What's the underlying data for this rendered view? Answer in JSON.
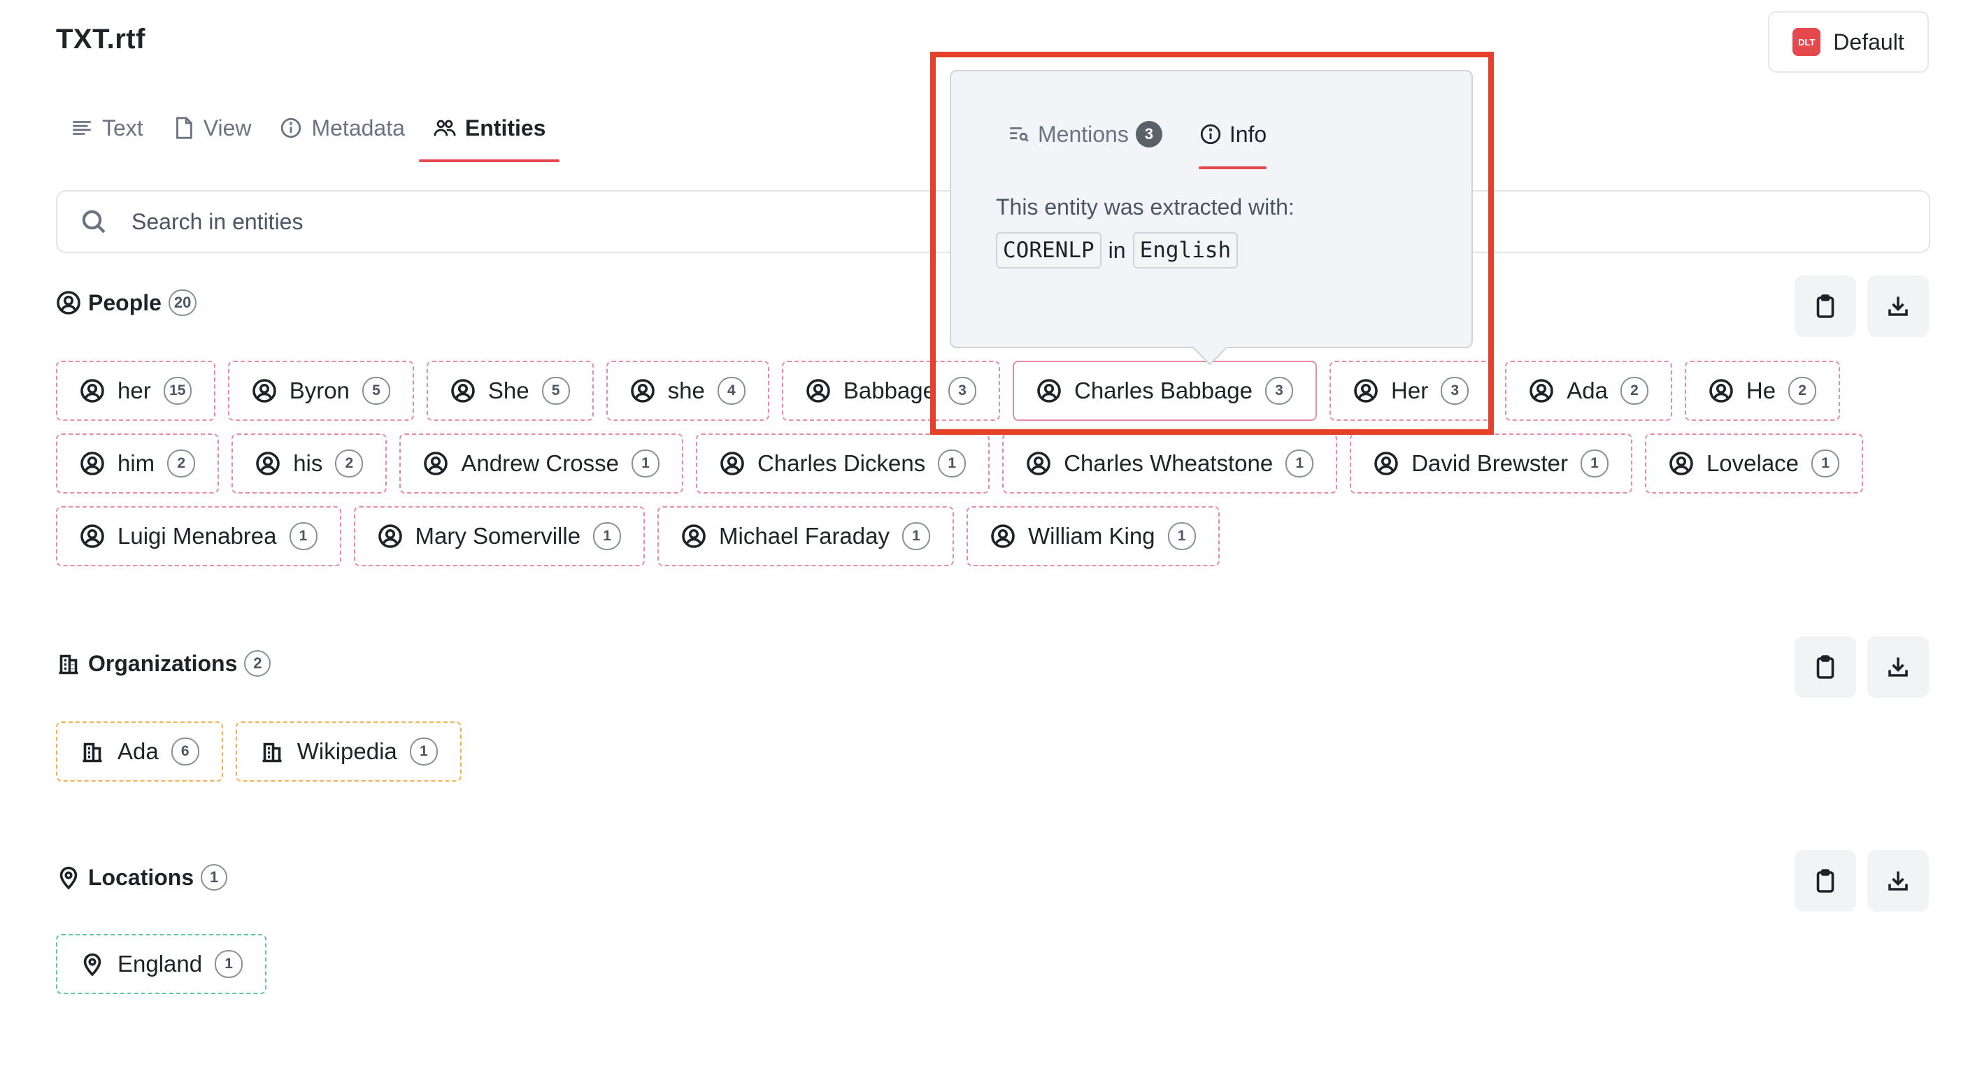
{
  "header": {
    "title": "TXT.rtf",
    "project_logo": "DLT",
    "project_label": "Default"
  },
  "tabs": [
    {
      "label": "Text",
      "icon": "text-lines-icon",
      "active": false
    },
    {
      "label": "View",
      "icon": "file-icon",
      "active": false
    },
    {
      "label": "Metadata",
      "icon": "info-icon",
      "active": false
    },
    {
      "label": "Entities",
      "icon": "people-icon",
      "active": true
    }
  ],
  "search": {
    "placeholder": "Search in entities",
    "value": ""
  },
  "sections": {
    "people": {
      "label": "People",
      "count": "20",
      "entities": [
        {
          "name": "her",
          "count": "15"
        },
        {
          "name": "Byron",
          "count": "5"
        },
        {
          "name": "She",
          "count": "5"
        },
        {
          "name": "she",
          "count": "4"
        },
        {
          "name": "Babbage",
          "count": "3"
        },
        {
          "name": "Charles Babbage",
          "count": "3"
        },
        {
          "name": "Her",
          "count": "3"
        },
        {
          "name": "Ada",
          "count": "2"
        },
        {
          "name": "He",
          "count": "2"
        },
        {
          "name": "him",
          "count": "2"
        },
        {
          "name": "his",
          "count": "2"
        },
        {
          "name": "Andrew Crosse",
          "count": "1"
        },
        {
          "name": "Charles Dickens",
          "count": "1"
        },
        {
          "name": "Charles Wheatstone",
          "count": "1"
        },
        {
          "name": "David Brewster",
          "count": "1"
        },
        {
          "name": "Lovelace",
          "count": "1"
        },
        {
          "name": "Luigi Menabrea",
          "count": "1"
        },
        {
          "name": "Mary Somerville",
          "count": "1"
        },
        {
          "name": "Michael Faraday",
          "count": "1"
        },
        {
          "name": "William King",
          "count": "1"
        }
      ]
    },
    "organizations": {
      "label": "Organizations",
      "count": "2",
      "entities": [
        {
          "name": "Ada",
          "count": "6"
        },
        {
          "name": "Wikipedia",
          "count": "1"
        }
      ]
    },
    "locations": {
      "label": "Locations",
      "count": "1",
      "entities": [
        {
          "name": "England",
          "count": "1"
        }
      ]
    }
  },
  "popover": {
    "tabs": [
      {
        "label": "Mentions",
        "badge": "3",
        "active": false
      },
      {
        "label": "Info",
        "active": true
      }
    ],
    "body": "This entity was extracted with:",
    "pipeline": "CORENLP",
    "connector": "in",
    "language": "English"
  },
  "colors": {
    "accent": "#e5484d",
    "person_border": "#e98ba2",
    "org_border": "#f2b14e",
    "location_border": "#5fc7a4",
    "highlight": "#e4402c"
  }
}
